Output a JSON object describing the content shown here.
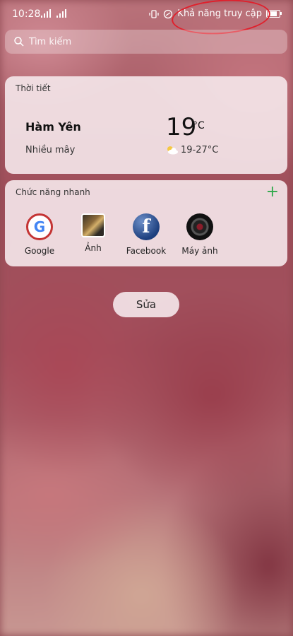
{
  "status": {
    "time": "10:28",
    "accessibility_text": "Khả năng truy cập"
  },
  "search": {
    "placeholder": "Tìm kiếm"
  },
  "weather": {
    "title": "Thời tiết",
    "city": "Hàm Yên",
    "condition": "Nhiều mây",
    "temperature": "19",
    "unit": "°C",
    "range": "19-27°C",
    "icon": "partly-cloudy-icon"
  },
  "quick_actions": {
    "title": "Chức năng nhanh",
    "add_icon": "+",
    "apps": [
      {
        "label": "Google",
        "icon": "google-icon"
      },
      {
        "label": "Ảnh",
        "icon": "photos-icon"
      },
      {
        "label": "Facebook",
        "icon": "facebook-icon"
      },
      {
        "label": "Máy ảnh",
        "icon": "camera-icon"
      }
    ]
  },
  "edit_button": {
    "label": "Sửa"
  },
  "colors": {
    "accent_plus": "#2ea84a",
    "annotation": "#e0202c"
  }
}
